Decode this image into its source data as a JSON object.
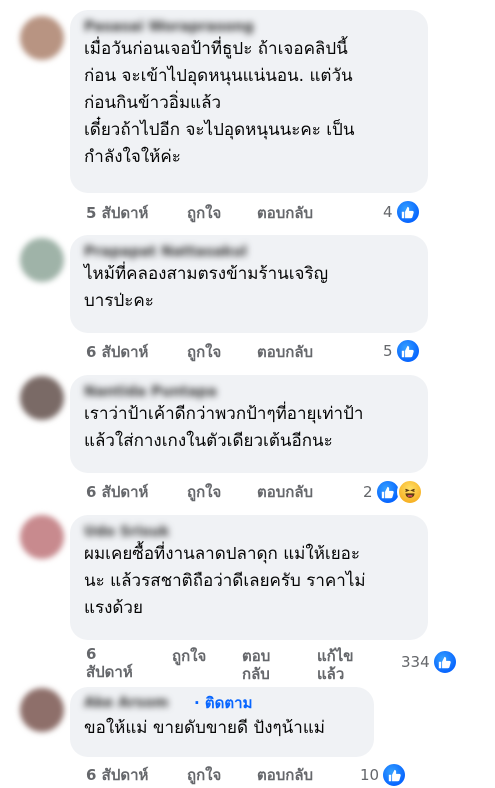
{
  "colors": {
    "bubble": "#f0f2f5",
    "meta": "#65676b",
    "like": "#0866ff",
    "link": "#0866ff"
  },
  "comments": [
    {
      "author": "Pasasai Woraprasong",
      "lines": [
        "เมื่อวันก่อนเจอป้าที่ธูปะ ถ้าเจอคลิปนี้",
        "ก่อน จะเข้าไปอุดหนุนแน่นอน. แต่วัน",
        "ก่อนกินข้าวอิ่มแล้ว",
        "เดี๋ยวถ้าไปอีก จะไปอุดหนุนนะคะ เป็น",
        "กำลังใจให้ค่ะ"
      ],
      "time": "5 สัปดาห์",
      "like": "ถูกใจ",
      "reply": "ตอบกลับ",
      "reaction_count": "4"
    },
    {
      "author": "Prapapat Nattasakul",
      "lines": [
        "ไหม้ที่คลองสามตรงข้ามร้านเจริญ",
        "บารป่ะคะ"
      ],
      "time": "6 สัปดาห์",
      "like": "ถูกใจ",
      "reply": "ตอบกลับ",
      "reaction_count": "5"
    },
    {
      "author": "Nantida Puntapa",
      "lines": [
        "เราว่าป้าเค้าดีกว่าพวกป้าๆที่อายุเท่าป้า",
        "แล้วใส่กางเกงในตัวเดียวเต้นอีกนะ"
      ],
      "time": "6 สัปดาห์",
      "like": "ถูกใจ",
      "reply": "ตอบกลับ",
      "reaction_count": "2"
    },
    {
      "author": "Udo Srisuk",
      "lines": [
        "ผมเคยซื้อที่งานลาดปลาดุก แม่ให้เยอะ",
        "นะ แล้วรสชาติถือว่าดีเลยครับ ราคาไม่",
        "แรงด้วย"
      ],
      "time_num": "6",
      "time_unit": "สัปดาห์",
      "like": "ถูกใจ",
      "reply_1": "ตอบ",
      "reply_2": "กลับ",
      "edited_1": "แก้ไข",
      "edited_2": "แล้ว",
      "reaction_count": "334"
    },
    {
      "author": "Ake Arsom",
      "follow": "· ติดตาม",
      "lines": [
        "ขอให้แม่ ขายดับขายดี ปังๆน้าแม่"
      ],
      "time": "6 สัปดาห์",
      "like": "ถูกใจ",
      "reply": "ตอบกลับ",
      "reaction_count": "10"
    }
  ]
}
